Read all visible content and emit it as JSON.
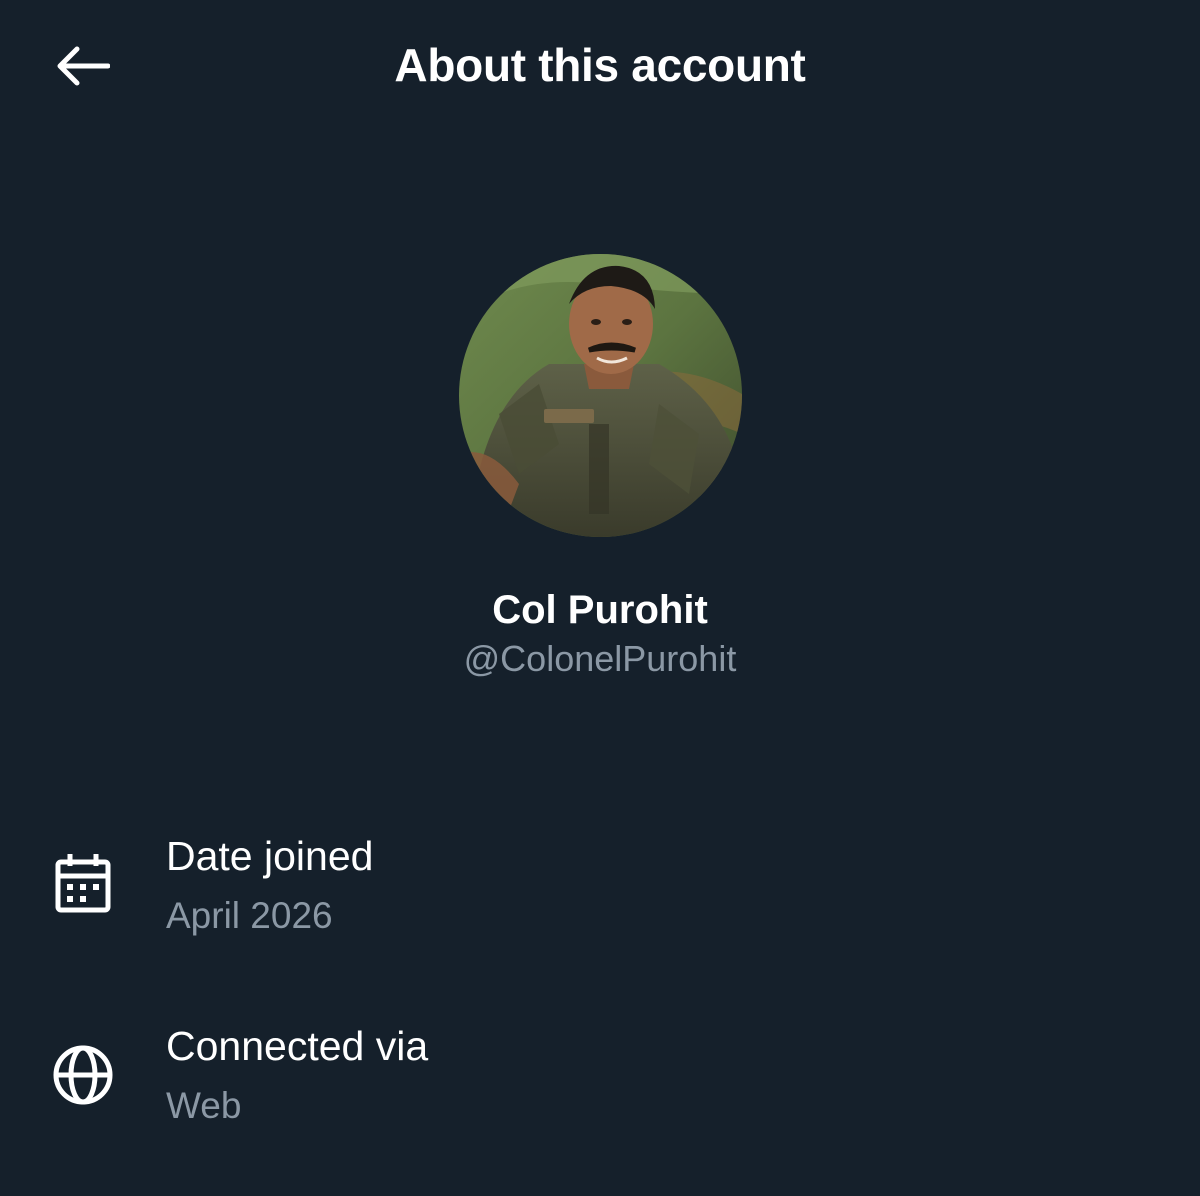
{
  "header": {
    "title": "About this account",
    "back_icon": "arrow-left-icon"
  },
  "profile": {
    "name": "Col Purohit",
    "handle": "@ColonelPurohit",
    "avatar_desc": "profile photo"
  },
  "details": [
    {
      "icon": "calendar-icon",
      "label": "Date joined",
      "value": "April 2026"
    },
    {
      "icon": "globe-icon",
      "label": "Connected via",
      "value": "Web"
    }
  ],
  "colors": {
    "background": "#15202b",
    "primary_text": "#ffffff",
    "secondary_text": "#8b98a5"
  }
}
